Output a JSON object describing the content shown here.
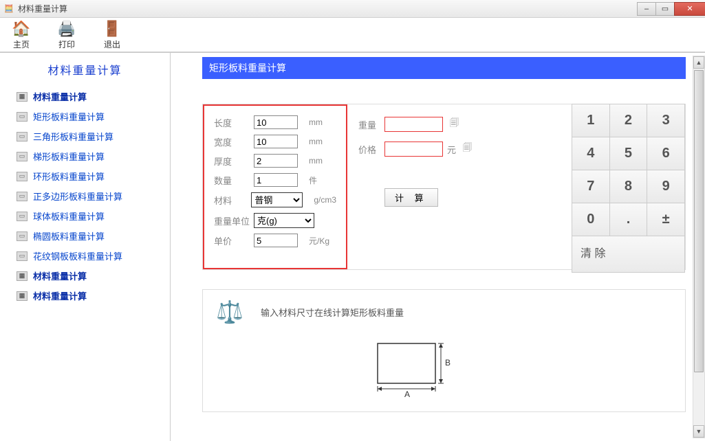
{
  "window": {
    "title": "材料重量计算",
    "min": "–",
    "max": "▭",
    "close": "✕"
  },
  "toolbar": {
    "home": "主页",
    "print": "打印",
    "exit": "退出"
  },
  "sidebar": {
    "title": "材料重量计算",
    "items": [
      {
        "label": "材料重量计算",
        "bold": true
      },
      {
        "label": "矩形板料重量计算",
        "bold": false
      },
      {
        "label": "三角形板料重量计算",
        "bold": false
      },
      {
        "label": "梯形板料重量计算",
        "bold": false
      },
      {
        "label": "环形板料重量计算",
        "bold": false
      },
      {
        "label": "正多边形板料重量计算",
        "bold": false
      },
      {
        "label": "球体板料重量计算",
        "bold": false
      },
      {
        "label": "椭圆板料重量计算",
        "bold": false
      },
      {
        "label": "花纹钢板板料重量计算",
        "bold": false
      },
      {
        "label": "材料重量计算",
        "bold": true
      },
      {
        "label": "材料重量计算",
        "bold": true
      }
    ]
  },
  "panel": {
    "header": "矩形板料重量计算"
  },
  "inputs": {
    "length_label": "长度",
    "length_value": "10",
    "length_unit": "mm",
    "width_label": "宽度",
    "width_value": "10",
    "width_unit": "mm",
    "thick_label": "厚度",
    "thick_value": "2",
    "thick_unit": "mm",
    "qty_label": "数量",
    "qty_value": "1",
    "qty_unit": "件",
    "mat_label": "材料",
    "mat_value": "普钢",
    "mat_unit": "g/cm3",
    "wunit_label": "重量单位",
    "wunit_value": "克(g)",
    "price_label": "单价",
    "price_value": "5",
    "price_unit": "元/Kg"
  },
  "outputs": {
    "weight_label": "重量",
    "weight_value": "",
    "price_label": "价格",
    "price_value": "",
    "price_unit": "元",
    "calc_btn": "计 算"
  },
  "keypad": {
    "k1": "1",
    "k2": "2",
    "k3": "3",
    "k4": "4",
    "k5": "5",
    "k6": "6",
    "k7": "7",
    "k8": "8",
    "k9": "9",
    "k0": "0",
    "kdot": ".",
    "kpm": "±",
    "kclear": "清\n除"
  },
  "info": {
    "text": "输入材料尺寸在线计算矩形板料重量",
    "dim_a": "A",
    "dim_b": "B"
  }
}
